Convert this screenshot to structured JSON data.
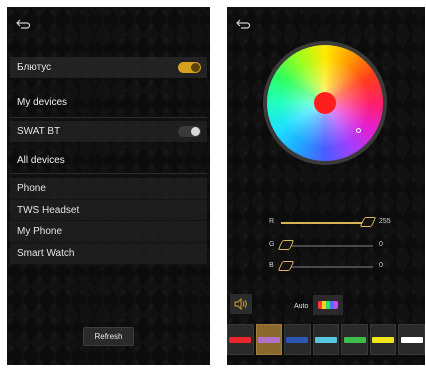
{
  "left": {
    "bluetooth_label": "Блютус",
    "bluetooth_enabled": true,
    "my_devices_header": "My devices",
    "paired_device": {
      "name": "SWAT BT",
      "enabled": false
    },
    "all_devices_header": "All devices",
    "devices": [
      "Phone",
      "TWS Headset",
      "My Phone",
      "Smart Watch"
    ],
    "refresh_label": "Refresh"
  },
  "right": {
    "sliders": [
      {
        "channel": "R",
        "value": 255
      },
      {
        "channel": "G",
        "value": 0
      },
      {
        "channel": "B",
        "value": 0
      }
    ],
    "auto_label": "Auto",
    "selected_color": "#ff1e1e",
    "swatches": [
      "#e8252c",
      "#b072c8",
      "#2d56b5",
      "#57c7df",
      "#3fbd4a",
      "#f0e51a",
      "#ffffff"
    ],
    "selected_swatch_index": 1
  },
  "colors": {
    "accent": "#d4a21c",
    "background": "#0c0c0c"
  }
}
